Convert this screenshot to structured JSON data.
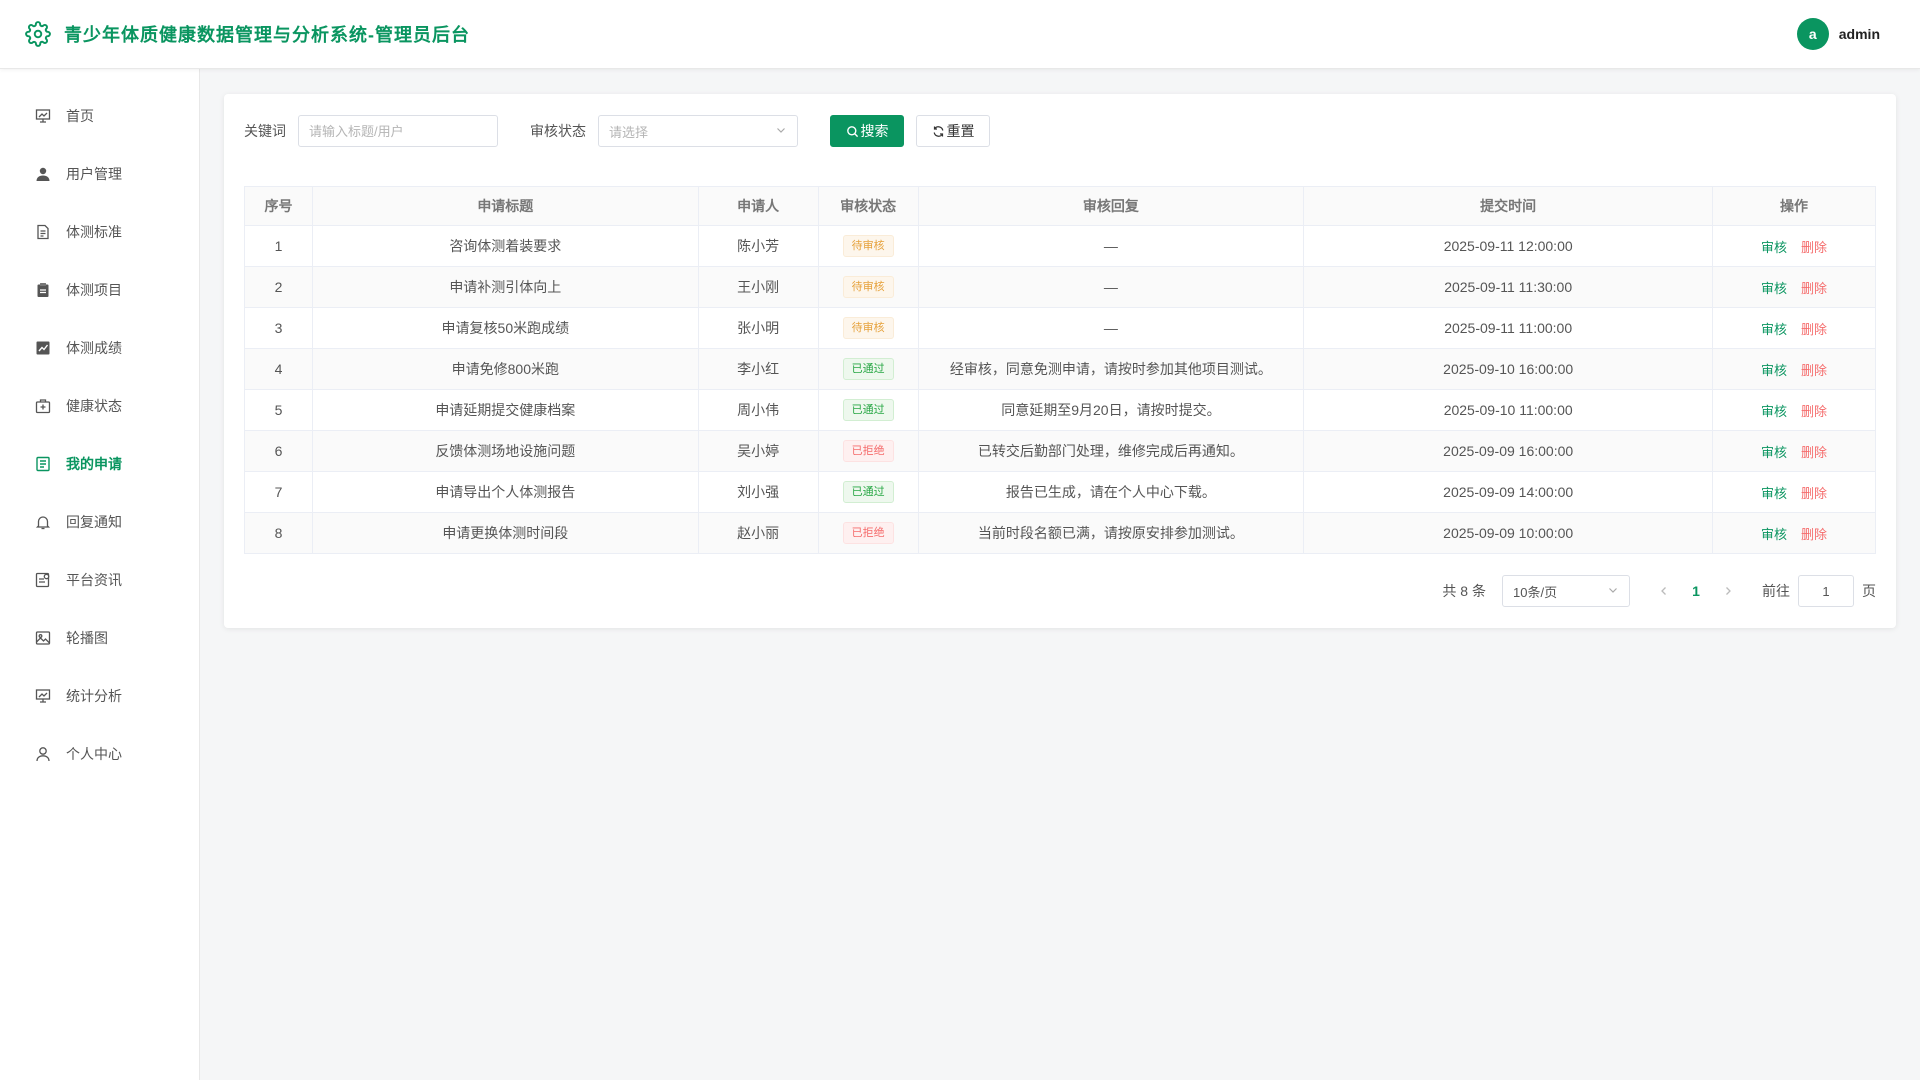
{
  "header": {
    "title": "青少年体质健康数据管理与分析系统-管理员后台",
    "avatar_letter": "a",
    "username": "admin",
    "brand_color": "#0a9560",
    "logo_icon": "gear-icon"
  },
  "sidebar": {
    "items": [
      {
        "label": "首页",
        "icon": "dashboard-icon"
      },
      {
        "label": "用户管理",
        "icon": "user-icon"
      },
      {
        "label": "体测标准",
        "icon": "document-icon"
      },
      {
        "label": "体测项目",
        "icon": "clipboard-icon"
      },
      {
        "label": "体测成绩",
        "icon": "chart-icon"
      },
      {
        "label": "健康状态",
        "icon": "medical-kit-icon"
      },
      {
        "label": "我的申请",
        "icon": "form-icon",
        "active": true
      },
      {
        "label": "回复通知",
        "icon": "bell-icon"
      },
      {
        "label": "平台资讯",
        "icon": "news-icon"
      },
      {
        "label": "轮播图",
        "icon": "image-icon"
      },
      {
        "label": "统计分析",
        "icon": "presentation-icon"
      },
      {
        "label": "个人中心",
        "icon": "person-icon"
      }
    ]
  },
  "filters": {
    "keyword_label": "关键词",
    "keyword_placeholder": "请输入标题/用户",
    "status_label": "审核状态",
    "status_placeholder": "请选择",
    "search_label": "搜索",
    "reset_label": "重置"
  },
  "table": {
    "columns": [
      "序号",
      "申请标题",
      "申请人",
      "审核状态",
      "审核回复",
      "提交时间",
      "操作"
    ],
    "rows": [
      {
        "no": "1",
        "title": "咨询体测着装要求",
        "applicant": "陈小芳",
        "status": "待审核",
        "status_type": "pending",
        "reply": "—",
        "time": "2025-09-11 12:00:00"
      },
      {
        "no": "2",
        "title": "申请补测引体向上",
        "applicant": "王小刚",
        "status": "待审核",
        "status_type": "pending",
        "reply": "—",
        "time": "2025-09-11 11:30:00"
      },
      {
        "no": "3",
        "title": "申请复核50米跑成绩",
        "applicant": "张小明",
        "status": "待审核",
        "status_type": "pending",
        "reply": "—",
        "time": "2025-09-11 11:00:00"
      },
      {
        "no": "4",
        "title": "申请免修800米跑",
        "applicant": "李小红",
        "status": "已通过",
        "status_type": "pass",
        "reply": "经审核，同意免测申请，请按时参加其他项目测试。",
        "time": "2025-09-10 16:00:00"
      },
      {
        "no": "5",
        "title": "申请延期提交健康档案",
        "applicant": "周小伟",
        "status": "已通过",
        "status_type": "pass",
        "reply": "同意延期至9月20日，请按时提交。",
        "time": "2025-09-10 11:00:00"
      },
      {
        "no": "6",
        "title": "反馈体测场地设施问题",
        "applicant": "吴小婷",
        "status": "已拒绝",
        "status_type": "reject",
        "reply": "已转交后勤部门处理，维修完成后再通知。",
        "time": "2025-09-09 16:00:00"
      },
      {
        "no": "7",
        "title": "申请导出个人体测报告",
        "applicant": "刘小强",
        "status": "已通过",
        "status_type": "pass",
        "reply": "报告已生成，请在个人中心下载。",
        "time": "2025-09-09 14:00:00"
      },
      {
        "no": "8",
        "title": "申请更换体测时间段",
        "applicant": "赵小丽",
        "status": "已拒绝",
        "status_type": "reject",
        "reply": "当前时段名额已满，请按原安排参加测试。",
        "time": "2025-09-09 10:00:00"
      }
    ],
    "audit_label": "审核",
    "delete_label": "删除"
  },
  "pagination": {
    "total_text": "共 8 条",
    "page_size": "10条/页",
    "current_page": "1",
    "goto_label": "前往",
    "goto_value": "1",
    "page_suffix": "页"
  }
}
